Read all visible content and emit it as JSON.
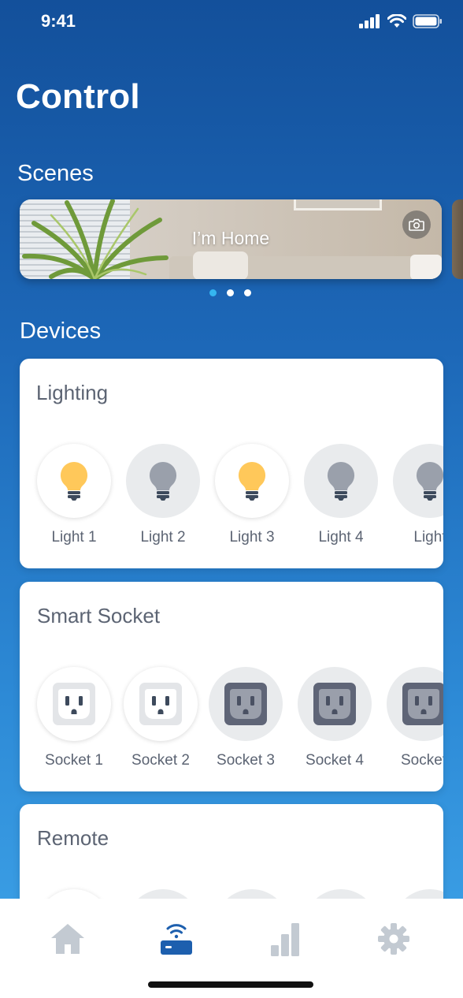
{
  "status_bar": {
    "time": "9:41"
  },
  "page": {
    "title": "Control"
  },
  "scenes": {
    "title": "Scenes",
    "cards": [
      {
        "label": "I’m Home"
      }
    ],
    "pager": {
      "count": 3,
      "active": 1
    }
  },
  "devices": {
    "title": "Devices",
    "lighting": {
      "title": "Lighting",
      "items": [
        {
          "label": "Light 1",
          "state": "on"
        },
        {
          "label": "Light 2",
          "state": "off"
        },
        {
          "label": "Light 3",
          "state": "on"
        },
        {
          "label": "Light 4",
          "state": "off"
        },
        {
          "label": "Light",
          "state": "off"
        }
      ]
    },
    "smart_socket": {
      "title": "Smart Socket",
      "items": [
        {
          "label": "Socket 1",
          "state": "on"
        },
        {
          "label": "Socket 2",
          "state": "on"
        },
        {
          "label": "Socket 3",
          "state": "off"
        },
        {
          "label": "Socket 4",
          "state": "off"
        },
        {
          "label": "Socket",
          "state": "off"
        }
      ]
    },
    "remote": {
      "title": "Remote"
    }
  },
  "tab_bar": {
    "items": [
      {
        "icon": "home-icon",
        "active": false
      },
      {
        "icon": "router-icon",
        "active": true
      },
      {
        "icon": "stats-icon",
        "active": false
      },
      {
        "icon": "gear-icon",
        "active": false
      }
    ]
  },
  "colors": {
    "accent": "#1d5fae",
    "pager_active": "#35b6f0",
    "bulb_on": "#ffc85a",
    "bulb_off": "#9aa0ab",
    "socket_off_bg": "#5f6577",
    "tab_inactive": "#c3cad2",
    "text_secondary": "#5c6473"
  }
}
